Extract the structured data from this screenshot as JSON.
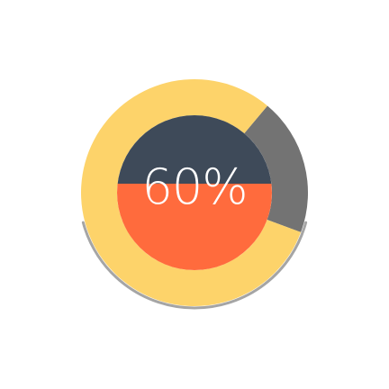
{
  "progress": {
    "value": 0.6,
    "label": "60%"
  },
  "colors": {
    "ring_fill": "#FDD36A",
    "ring_remainder": "#737373",
    "inner_top": "#3E4A59",
    "inner_bottom": "#FF6B3D",
    "label": "#FFFFFF",
    "shadow": "#5B5B5B"
  }
}
